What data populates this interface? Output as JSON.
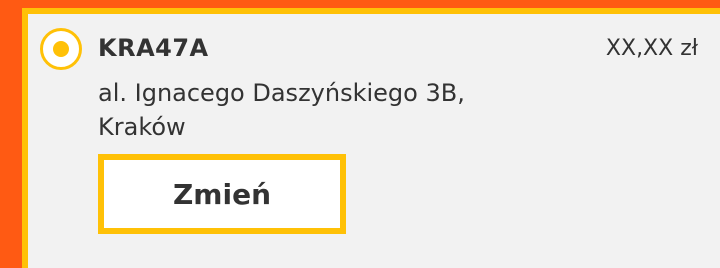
{
  "option": {
    "selected": true,
    "code": "KRA47A",
    "price": "XX,XX zł",
    "address_line1": "al. Ignacego Daszyńskiego 3B,",
    "address_line2": "Kraków",
    "change_button_label": "Zmień"
  },
  "colors": {
    "background": "#ff5a13",
    "accent": "#ffc107",
    "panel": "#f2f2f2",
    "text": "#333333"
  },
  "icons": {
    "radio": "radio-selected-icon"
  }
}
